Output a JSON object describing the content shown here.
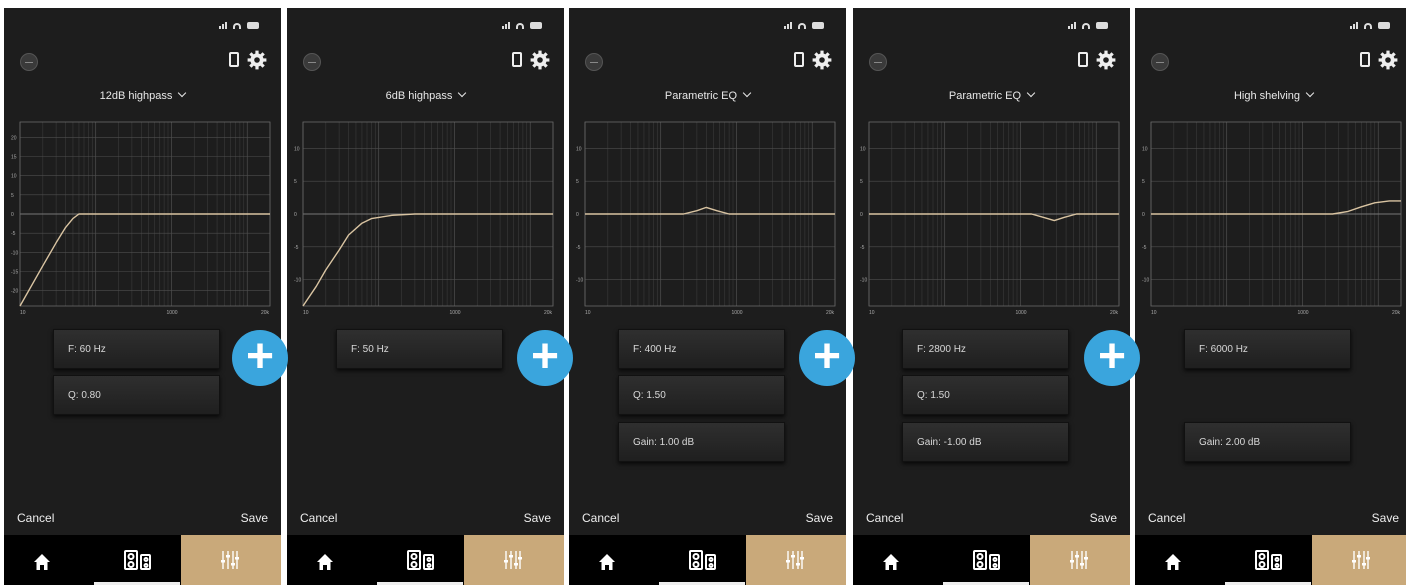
{
  "screens": [
    {
      "filter": "12dB highpass",
      "fields": [
        "F: 60 Hz",
        "Q: 0.80",
        ""
      ],
      "y_ticks": [
        "20",
        "15",
        "10",
        "5",
        "0",
        "-5",
        "-10",
        "-15",
        "-20"
      ],
      "ylim": [
        -24,
        24
      ],
      "curve": [
        [
          10,
          -24
        ],
        [
          20,
          -13.5
        ],
        [
          30,
          -7.5
        ],
        [
          40,
          -3.5
        ],
        [
          50,
          -1.2
        ],
        [
          60,
          0
        ],
        [
          100,
          0
        ],
        [
          20000,
          0
        ]
      ]
    },
    {
      "filter": "6dB highpass",
      "fields": [
        "F: 50 Hz",
        "",
        ""
      ],
      "y_ticks": [
        "10",
        "5",
        "0",
        "-5",
        "-10"
      ],
      "ylim": [
        -14,
        14
      ],
      "curve": [
        [
          10,
          -14
        ],
        [
          15,
          -11
        ],
        [
          20,
          -8.5
        ],
        [
          30,
          -5.5
        ],
        [
          40,
          -3.2
        ],
        [
          60,
          -1.4
        ],
        [
          80,
          -0.7
        ],
        [
          150,
          -0.2
        ],
        [
          300,
          0
        ],
        [
          20000,
          0
        ]
      ]
    },
    {
      "filter": "Parametric EQ",
      "fields": [
        "F: 400 Hz",
        "Q: 1.50",
        "Gain: 1.00 dB"
      ],
      "y_ticks": [
        "10",
        "5",
        "0",
        "-5",
        "-10"
      ],
      "ylim": [
        -14,
        14
      ],
      "curve": [
        [
          10,
          0
        ],
        [
          200,
          0
        ],
        [
          300,
          0.5
        ],
        [
          400,
          1
        ],
        [
          550,
          0.5
        ],
        [
          800,
          0
        ],
        [
          20000,
          0
        ]
      ]
    },
    {
      "filter": "Parametric EQ",
      "fields": [
        "F: 2800 Hz",
        "Q: 1.50",
        "Gain: -1.00 dB"
      ],
      "y_ticks": [
        "10",
        "5",
        "0",
        "-5",
        "-10"
      ],
      "ylim": [
        -14,
        14
      ],
      "curve": [
        [
          10,
          0
        ],
        [
          1400,
          0
        ],
        [
          2000,
          -0.5
        ],
        [
          2800,
          -1
        ],
        [
          3800,
          -0.5
        ],
        [
          5500,
          0
        ],
        [
          20000,
          0
        ]
      ]
    },
    {
      "filter": "High shelving",
      "fields": [
        "F: 6000 Hz",
        "",
        "Gain: 2.00 dB"
      ],
      "y_ticks": [
        "10",
        "5",
        "0",
        "-5",
        "-10"
      ],
      "ylim": [
        -14,
        14
      ],
      "curve": [
        [
          10,
          0
        ],
        [
          2500,
          0
        ],
        [
          4000,
          0.4
        ],
        [
          6000,
          1.1
        ],
        [
          9000,
          1.7
        ],
        [
          14000,
          2
        ],
        [
          20000,
          2
        ]
      ]
    }
  ],
  "x_ticks": [
    "10",
    "1000",
    "20k"
  ],
  "buttons": {
    "cancel": "Cancel",
    "save": "Save",
    "add": "+"
  },
  "colors": {
    "background": "#1d1d1d",
    "curve": "#d9c4a2",
    "grid": "#4e4e4e",
    "active_tab": "#c9a97a",
    "add_button": "#3aa5dd"
  }
}
